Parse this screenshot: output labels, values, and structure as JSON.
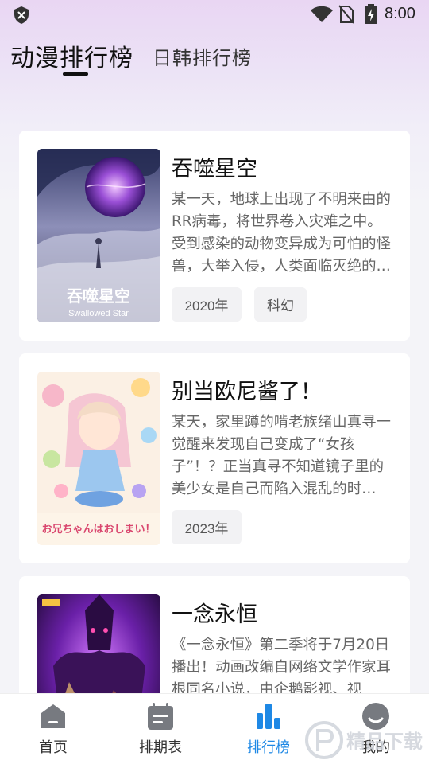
{
  "status": {
    "time": "8:00"
  },
  "tabs": {
    "active": "动漫排行榜",
    "other": "日韩排行榜"
  },
  "cards": [
    {
      "title": "吞噬星空",
      "desc": "某一天，地球上出现了不明来由的RR病毒，将世界卷入灾难之中。受到感染的动物变异成为可怕的怪兽，大举入侵，人类面临灭绝的危机……",
      "tags": [
        "2020年",
        "科幻"
      ],
      "poster_text": [
        "吞噬星空",
        "Swallowed Star"
      ]
    },
    {
      "title": "别当欧尼酱了！",
      "desc": "某天，家里蹲的啃老族绪山真寻一觉醒来发现自己变成了“女孩子”！？正当真寻不知道镜子里的美少女是自己而陷入混乱的时候……",
      "tags": [
        "2023年"
      ],
      "poster_text": [
        "お兄ちゃんはおしまい！"
      ]
    },
    {
      "title": "一念永恒",
      "desc": "《一念永恒》第二季将于7月20日播出！动画改编自网络文学作家耳根同名小说，由企鹅影视、视",
      "tags": []
    }
  ],
  "nav": [
    {
      "label": "首页",
      "icon": "home-icon"
    },
    {
      "label": "排期表",
      "icon": "calendar-icon"
    },
    {
      "label": "排行榜",
      "icon": "rank-icon",
      "active": true
    },
    {
      "label": "我的",
      "icon": "profile-icon"
    }
  ],
  "watermark": "精品下载",
  "colors": {
    "accent": "#1e88e5",
    "nav_inactive": "#777a80"
  }
}
